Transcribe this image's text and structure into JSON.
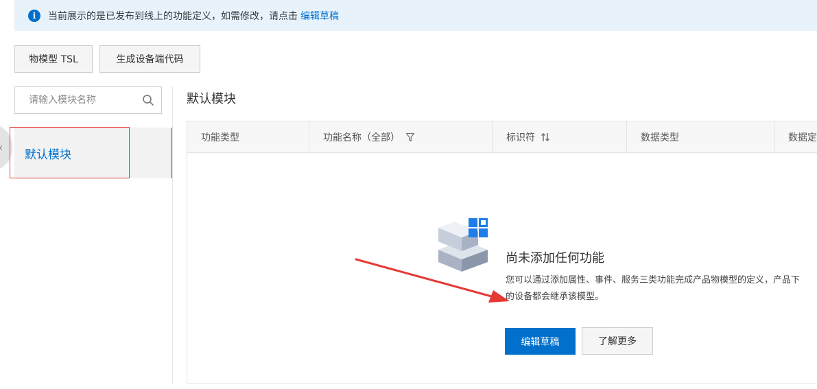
{
  "notice": {
    "text": "当前展示的是已发布到线上的功能定义，如需修改，请点击",
    "link": "编辑草稿"
  },
  "toolbar": {
    "tsl_label": "物模型 TSL",
    "gen_code_label": "生成设备端代码"
  },
  "search": {
    "placeholder": "请输入模块名称"
  },
  "sidebar": {
    "items": [
      {
        "label": "默认模块",
        "selected": true
      }
    ]
  },
  "module": {
    "title": "默认模块"
  },
  "table": {
    "columns": [
      {
        "label": "功能类型"
      },
      {
        "label": "功能名称（全部）",
        "icon": "filter-icon"
      },
      {
        "label": "标识符",
        "icon": "sort-icon"
      },
      {
        "label": "数据类型"
      },
      {
        "label": "数据定义"
      }
    ]
  },
  "empty_state": {
    "title": "尚未添加任何功能",
    "desc_line1": "您可以通过添加属性、事件、服务三类功能完成产品物模型的定义，产品下",
    "desc_line2": "的设备都会继承该模型。",
    "primary_label": "编辑草稿",
    "secondary_label": "了解更多"
  },
  "colors": {
    "accent": "#0070cc",
    "annotation": "#e53935"
  }
}
